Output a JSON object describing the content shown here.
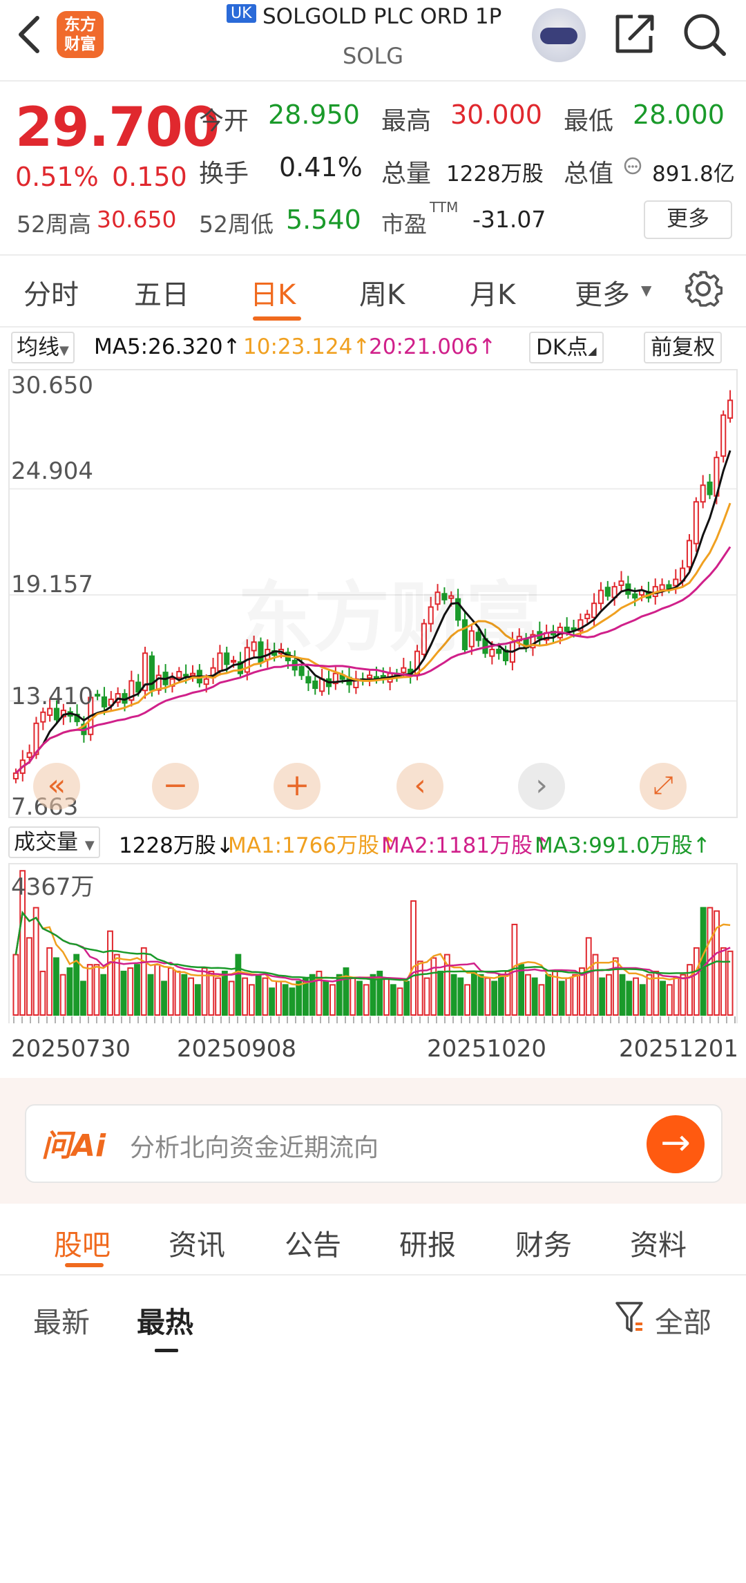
{
  "header": {
    "back_icon": "chevron-left-icon",
    "logo_text": "东方财富",
    "market_badge": "UK",
    "title": "SOLGOLD PLC ORD 1P",
    "ticker": "SOLG",
    "share_icon": "share-icon",
    "search_icon": "search-icon"
  },
  "quote": {
    "price": "29.700",
    "change_pct": "0.51%",
    "change_abs": "0.150",
    "open_label": "今开",
    "open": "28.950",
    "high_label": "最高",
    "high": "30.000",
    "low_label": "最低",
    "low": "28.000",
    "turnover_label": "换手",
    "turnover": "0.41%",
    "volume_label": "总量",
    "volume": "1228万股",
    "mktcap_label": "总值",
    "mktcap": "891.8亿",
    "w52_high_label": "52周高",
    "w52_high": "30.650",
    "w52_low_label": "52周低",
    "w52_low": "5.540",
    "pe_label": "市盈",
    "pe_sup": "TTM",
    "pe": "-31.07",
    "more": "更多"
  },
  "chart_tabs": [
    {
      "label": "分时"
    },
    {
      "label": "五日"
    },
    {
      "label": "日K",
      "active": true
    },
    {
      "label": "周K"
    },
    {
      "label": "月K"
    },
    {
      "label": "更多"
    }
  ],
  "ma_row": {
    "indicator": "均线",
    "ma5": "MA5:26.320↑",
    "ma10": "10:23.124↑",
    "ma20": "20:21.006↑",
    "dk": "DK点",
    "adjust": "前复权"
  },
  "vol_row": {
    "indicator": "成交量",
    "vol": "1228万股↓",
    "ma1": "MA1:1766万股↑",
    "ma2": "MA2:1181万股↑",
    "ma3": "MA3:991.0万股↑"
  },
  "colors": {
    "up": "#e0282e",
    "down": "#1a9a2a",
    "accent": "#f06a1e",
    "ma5": "#111111",
    "ma10": "#f0a020",
    "ma20": "#d0208a"
  },
  "chart_data": [
    {
      "type": "candlestick",
      "y_ticks": [
        "30.650",
        "24.904",
        "19.157",
        "13.410",
        "7.663"
      ],
      "ylim": [
        7.663,
        30.65
      ],
      "x_ticks": [
        "20250730",
        "20250908",
        "20251020",
        "20251201"
      ],
      "closes": [
        9.5,
        10.2,
        10.6,
        12.2,
        12.8,
        13.0,
        12.4,
        12.9,
        12.6,
        12.3,
        11.6,
        13.6,
        13.7,
        13.1,
        13.5,
        13.8,
        13.3,
        14.5,
        13.9,
        16.0,
        14.0,
        14.8,
        14.3,
        14.6,
        15.0,
        14.8,
        14.9,
        14.4,
        14.6,
        15.2,
        16.0,
        15.4,
        15.6,
        14.9,
        16.3,
        16.6,
        15.5,
        16.2,
        15.9,
        16.2,
        15.6,
        15.1,
        14.8,
        14.4,
        14.1,
        14.6,
        14.2,
        14.9,
        14.6,
        14.3,
        14.6,
        14.5,
        14.8,
        14.7,
        14.6,
        14.9,
        14.8,
        15.2,
        14.8,
        16.1,
        17.6,
        18.5,
        19.3,
        18.9,
        19.1,
        17.8,
        16.2,
        17.2,
        16.7,
        16.0,
        16.2,
        16.0,
        15.6,
        16.6,
        16.9,
        16.3,
        17.0,
        16.8,
        17.1,
        17.0,
        17.4,
        17.2,
        17.3,
        17.8,
        18.1,
        18.7,
        19.4,
        19.1,
        19.6,
        19.9,
        19.2,
        19.0,
        19.4,
        19.0,
        19.6,
        19.7,
        19.5,
        20.0,
        20.6,
        22.1,
        24.2,
        25.1,
        24.6,
        26.6,
        28.9,
        29.7
      ]
    },
    {
      "type": "bar",
      "name": "成交量",
      "y_ticks": [
        "4367万"
      ],
      "values": [
        1800,
        4300,
        2300,
        3200,
        1300,
        2000,
        1700,
        1200,
        1400,
        1800,
        1000,
        1500,
        1500,
        1200,
        2500,
        1800,
        1300,
        1400,
        1500,
        2000,
        1200,
        1500,
        1000,
        1400,
        1300,
        1200,
        1100,
        900,
        1400,
        1300,
        1100,
        1300,
        1000,
        1800,
        1100,
        900,
        1200,
        1100,
        800,
        1000,
        900,
        800,
        1000,
        1100,
        1200,
        1300,
        1000,
        900,
        1200,
        1400,
        1100,
        1000,
        900,
        1200,
        1300,
        1100,
        900,
        800,
        1000,
        3400,
        1600,
        1100,
        1700,
        1300,
        1800,
        1200,
        1100,
        900,
        1300,
        1200,
        1100,
        1000,
        1200,
        1300,
        2700,
        1500,
        1200,
        1100,
        900,
        1200,
        1300,
        1000,
        1100,
        1200,
        1400,
        2300,
        1800,
        1100,
        1200,
        1700,
        1200,
        1000,
        1100,
        900,
        1200,
        1300,
        1000,
        900,
        1100,
        1200,
        1500,
        2000,
        3200,
        3200,
        3100,
        2000,
        1900
      ],
      "ma_lines": [
        "MA1",
        "MA2",
        "MA3"
      ]
    }
  ],
  "controls": [
    "fast-backward-icon",
    "zoom-out-icon",
    "zoom-in-icon",
    "prev-icon",
    "next-icon",
    "fullscreen-icon"
  ],
  "ai_bar": {
    "logo": "问Ai",
    "prompt": "分析北向资金近期流向"
  },
  "bottom_tabs": [
    {
      "label": "股吧",
      "active": true
    },
    {
      "label": "资讯"
    },
    {
      "label": "公告"
    },
    {
      "label": "研报"
    },
    {
      "label": "财务"
    },
    {
      "label": "资料"
    }
  ],
  "sub_tabs": {
    "latest": "最新",
    "hottest": "最热",
    "filter": "全部"
  }
}
